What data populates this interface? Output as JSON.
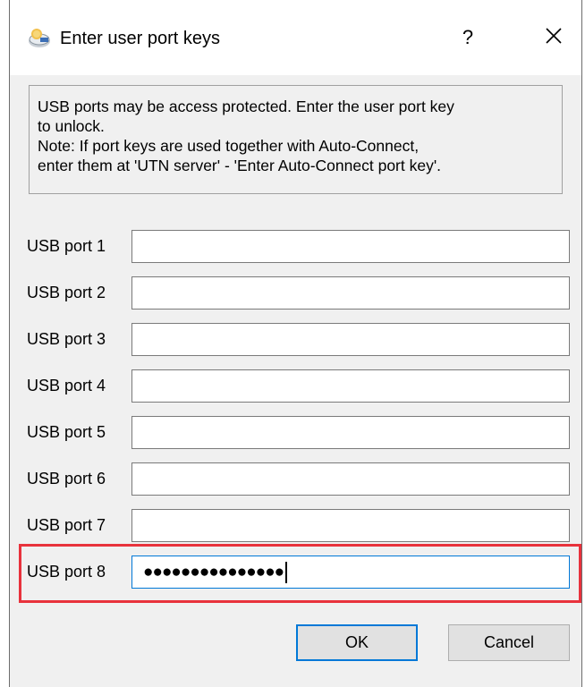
{
  "window": {
    "title": "Enter user port keys",
    "help_label": "?",
    "app_icon": "usb-hub-icon",
    "close_icon": "close-icon"
  },
  "info": {
    "text": "USB ports may be access protected. Enter the user port key\nto unlock.\nNote: If port keys are used together with Auto-Connect,\nenter them at 'UTN server' - 'Enter Auto-Connect port key'."
  },
  "ports": [
    {
      "label": "USB port 1",
      "value": ""
    },
    {
      "label": "USB port 2",
      "value": ""
    },
    {
      "label": "USB port 3",
      "value": ""
    },
    {
      "label": "USB port 4",
      "value": ""
    },
    {
      "label": "USB port 5",
      "value": ""
    },
    {
      "label": "USB port 6",
      "value": ""
    },
    {
      "label": "USB port 7",
      "value": ""
    },
    {
      "label": "USB port 8",
      "value": "●●●●●●●●●●●●●●●",
      "focused": true
    }
  ],
  "buttons": {
    "ok": "OK",
    "cancel": "Cancel"
  },
  "colors": {
    "accent": "#0078d7",
    "highlight": "#e8323c"
  }
}
